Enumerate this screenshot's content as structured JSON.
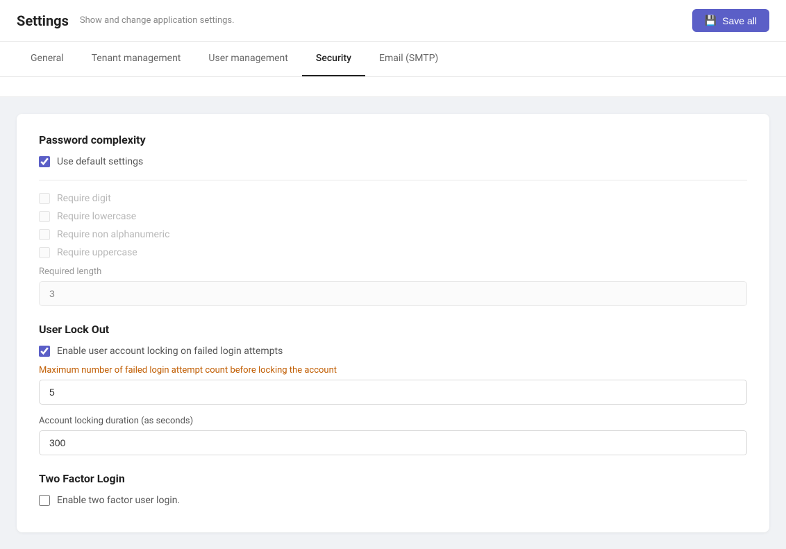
{
  "header": {
    "title": "Settings",
    "subtitle": "Show and change application settings.",
    "save_button": "Save all",
    "save_icon": "💾"
  },
  "tabs": [
    {
      "id": "general",
      "label": "General",
      "active": false
    },
    {
      "id": "tenant-management",
      "label": "Tenant management",
      "active": false
    },
    {
      "id": "user-management",
      "label": "User management",
      "active": false
    },
    {
      "id": "security",
      "label": "Security",
      "active": true
    },
    {
      "id": "email-smtp",
      "label": "Email (SMTP)",
      "active": false
    }
  ],
  "sections": {
    "password_complexity": {
      "title": "Password complexity",
      "use_default_settings_label": "Use default settings",
      "use_default_settings_checked": true,
      "require_digit_label": "Require digit",
      "require_digit_checked": false,
      "require_lowercase_label": "Require lowercase",
      "require_lowercase_checked": false,
      "require_non_alphanumeric_label": "Require non alphanumeric",
      "require_non_alphanumeric_checked": false,
      "require_uppercase_label": "Require uppercase",
      "require_uppercase_checked": false,
      "required_length_label": "Required length",
      "required_length_value": "3"
    },
    "user_lock_out": {
      "title": "User Lock Out",
      "enable_locking_label": "Enable user account locking on failed login attempts",
      "enable_locking_checked": true,
      "max_attempts_label": "Maximum number of failed login attempt count before locking the account",
      "max_attempts_value": "5",
      "locking_duration_label": "Account locking duration (as seconds)",
      "locking_duration_value": "300"
    },
    "two_factor": {
      "title": "Two Factor Login",
      "enable_label": "Enable two factor user login.",
      "enable_checked": false
    }
  }
}
